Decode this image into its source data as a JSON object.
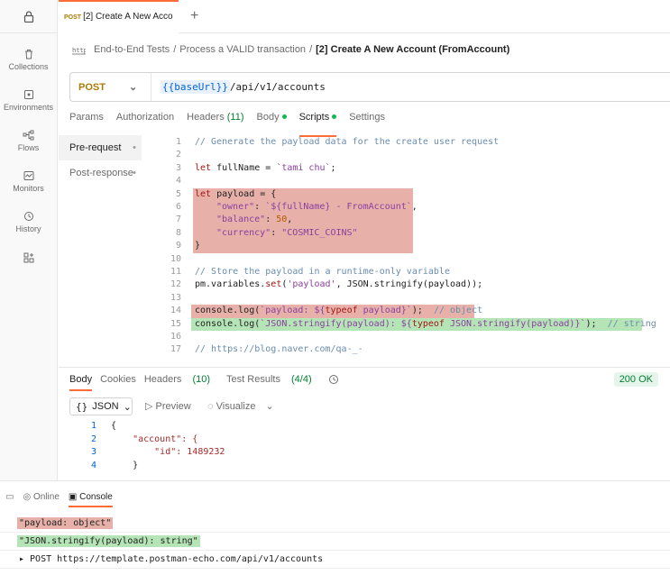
{
  "rail": {
    "items": [
      {
        "label": "Collections",
        "icon": "trash-can-icon"
      },
      {
        "label": "Environments",
        "icon": "environment-icon"
      },
      {
        "label": "Flows",
        "icon": "flows-icon"
      },
      {
        "label": "Monitors",
        "icon": "monitor-icon"
      },
      {
        "label": "History",
        "icon": "history-icon"
      }
    ]
  },
  "tab": {
    "method": "POST",
    "title": "[2] Create A New Acco",
    "add": "+"
  },
  "breadcrumb": {
    "items": [
      "End-to-End Tests",
      "Process a VALID transaction"
    ],
    "current": "[2] Create A New Account (FromAccount)",
    "sep": "/"
  },
  "urlbar": {
    "method": "POST",
    "var": "{{baseUrl}}",
    "path": "/api/v1/accounts"
  },
  "req_tabs": {
    "params": "Params",
    "authorization": "Authorization",
    "headers": "Headers",
    "headers_count": "(11)",
    "body": "Body",
    "scripts": "Scripts",
    "settings": "Settings"
  },
  "script_nav": {
    "pre": "Pre-request",
    "post": "Post-response",
    "bullet": "•"
  },
  "code": {
    "lines": [
      {
        "n": "1"
      },
      {
        "n": "2"
      },
      {
        "n": "3"
      },
      {
        "n": "4"
      },
      {
        "n": "5"
      },
      {
        "n": "6"
      },
      {
        "n": "7"
      },
      {
        "n": "8"
      },
      {
        "n": "9"
      },
      {
        "n": "10"
      },
      {
        "n": "11"
      },
      {
        "n": "12"
      },
      {
        "n": "13"
      },
      {
        "n": "14"
      },
      {
        "n": "15"
      },
      {
        "n": "16"
      },
      {
        "n": "17"
      }
    ],
    "l1": "// Generate the payload data for the create user request",
    "l3_kw": "let",
    "l3_a": " fullName = ",
    "l3_str": "`tami chu`",
    "l3_b": ";",
    "l5_kw": "let",
    "l5_a": " payload = {",
    "l6_prop": "\"owner\"",
    "l6_a": ": ",
    "l6_str": "`${fullName} - FromAccount`",
    "l6_b": ",",
    "l7_prop": "\"balance\"",
    "l7_a": ": ",
    "l7_num": "50",
    "l7_b": ",",
    "l8_prop": "\"currency\"",
    "l8_a": ": ",
    "l8_str": "\"COSMIC_COINS\"",
    "l9": "}",
    "l11": "// Store the payload in a runtime-only variable",
    "l12_a": "pm.variables.",
    "l12_kw": "set",
    "l12_b": "(",
    "l12_str": "'payload'",
    "l12_c": ", JSON.stringify(payload));",
    "l14_a": "console.log(",
    "l14_str": "`payload: ${",
    "l14_kw": "typeof",
    "l14_str2": " payload}`",
    "l14_b": ");  ",
    "l14_cmt": "// object",
    "l15_a": "console.log(",
    "l15_str": "`JSON.stringify(payload): ${",
    "l15_kw": "typeof",
    "l15_b": " JSON.stringify(payload)}`",
    "l15_c": ");  ",
    "l15_cmt": "// string",
    "l17": "// https://blog.naver.com/qa-_-"
  },
  "response": {
    "tabs": {
      "body": "Body",
      "cookies": "Cookies",
      "headers": "Headers",
      "headers_count": "(10)",
      "tests": "Test Results",
      "tests_count": "(4/4)"
    },
    "status": "200 OK",
    "format": "JSON",
    "preview": "Preview",
    "visualize": "Visualize",
    "lines": [
      {
        "n": "1",
        "t": "{"
      },
      {
        "n": "2",
        "t": "    \"account\": {"
      },
      {
        "n": "3",
        "t": "        \"id\": 1489232"
      },
      {
        "n": "4",
        "t": "    }"
      }
    ]
  },
  "console": {
    "online": "Online",
    "console": "Console",
    "log1": "\"payload: object\"",
    "log2": "\"JSON.stringify(payload): string\"",
    "log3": "▸ POST https://template.postman-echo.com/api/v1/accounts"
  },
  "colors": {
    "accent": "#ff6c37",
    "status_ok": "#007f31",
    "method": "#ad7a03",
    "hl_red": "#e7b1a9",
    "hl_green": "#b5e4b6"
  }
}
